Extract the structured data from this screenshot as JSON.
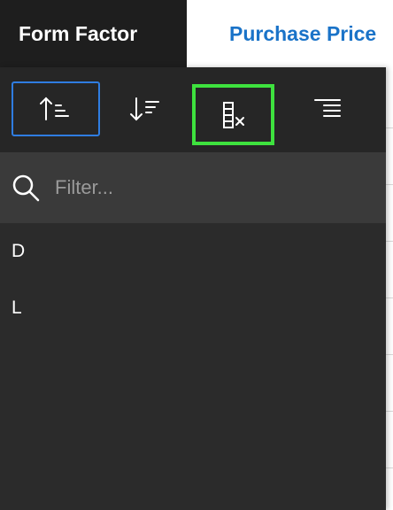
{
  "header": {
    "col1": "Form Factor",
    "col2": "Purchase Price"
  },
  "toolbar": {
    "buttons": [
      {
        "icon": "sort-ascending-icon",
        "state": "active"
      },
      {
        "icon": "sort-descending-icon",
        "state": "normal"
      },
      {
        "icon": "clear-column-filter-icon",
        "state": "highlighted"
      },
      {
        "icon": "align-right-icon",
        "state": "normal"
      }
    ]
  },
  "filter": {
    "placeholder": "Filter...",
    "value": ""
  },
  "list": {
    "items": [
      "D",
      "L"
    ]
  },
  "colors": {
    "accent_blue": "#2f7de1",
    "highlight_green": "#3ee23e",
    "header_link_blue": "#1a73c8",
    "popup_bg": "#2b2b2b"
  }
}
